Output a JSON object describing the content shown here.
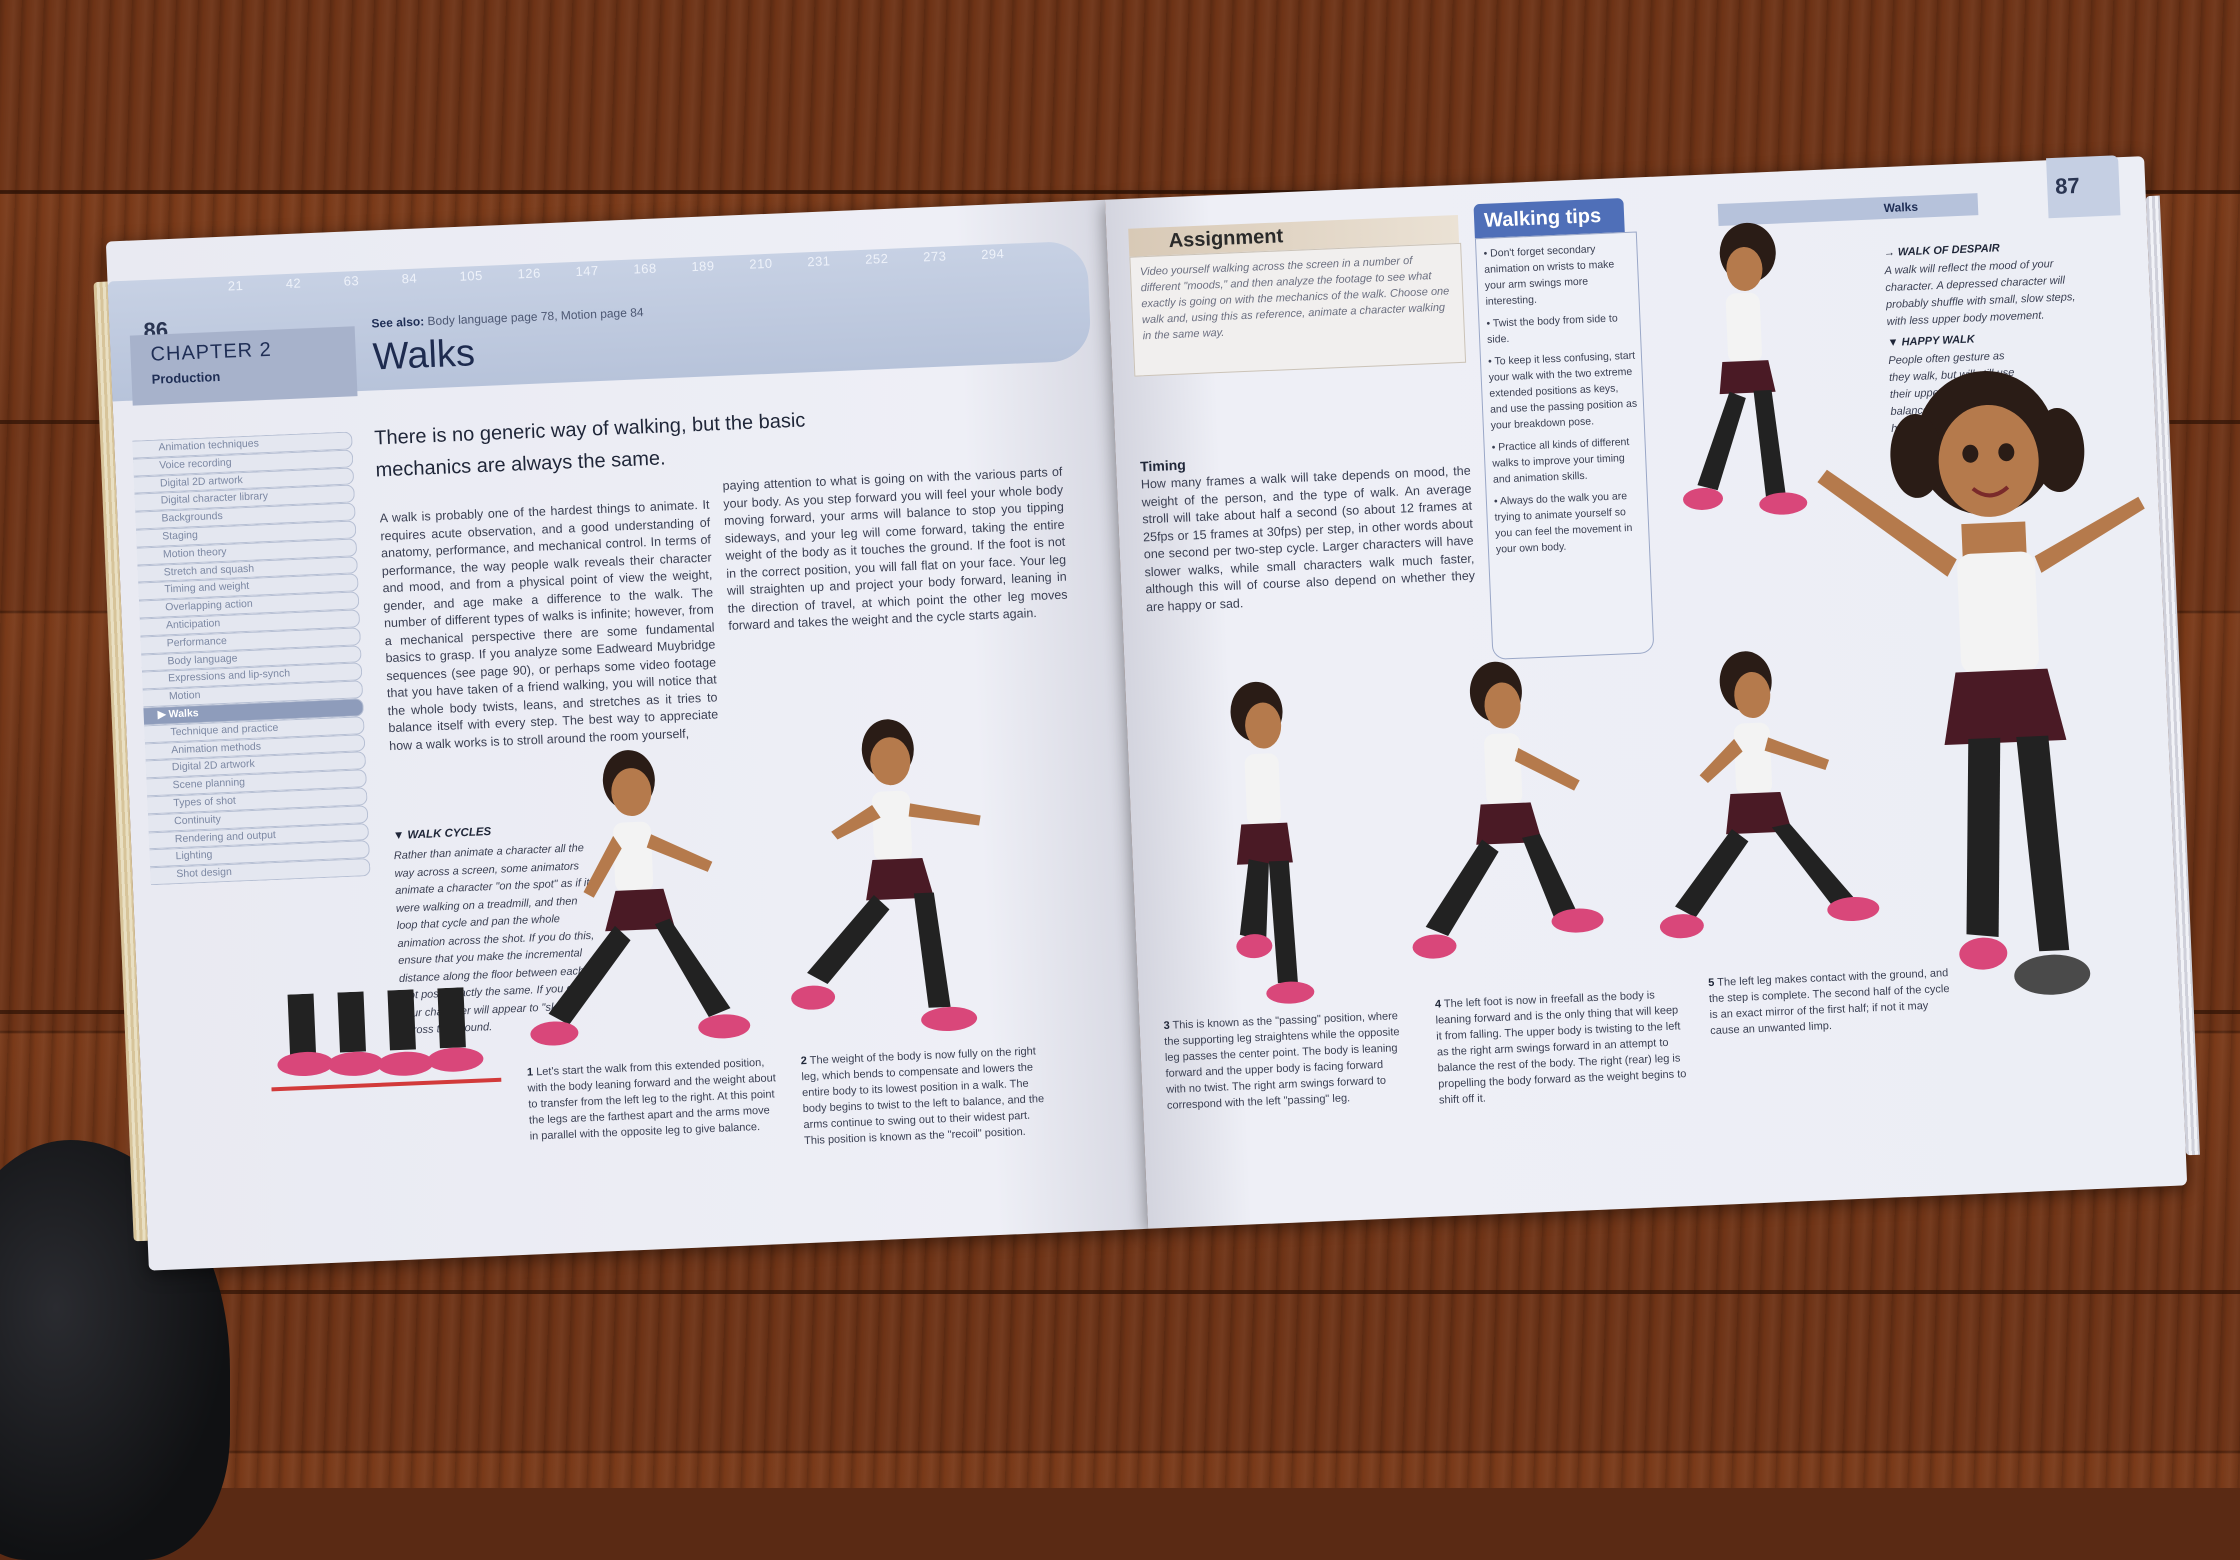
{
  "left_page": {
    "page_number": "86",
    "chapter": "CHAPTER 2",
    "chapter_sub": "Production",
    "see_also_label": "See also:",
    "see_also_text": "Body language page 78, Motion page 84",
    "title": "Walks",
    "toc": [
      "Animation techniques",
      "Voice recording",
      "Digital 2D artwork",
      "Digital character library",
      "Backgrounds",
      "Staging",
      "Motion theory",
      "Stretch and squash",
      "Timing and weight",
      "Overlapping action",
      "Anticipation",
      "Performance",
      "Body language",
      "Expressions and lip-synch",
      "Motion",
      "▶ Walks",
      "Technique and practice",
      "Animation methods",
      "Digital 2D artwork",
      "Scene planning",
      "Types of shot",
      "Continuity",
      "Rendering and output",
      "Lighting",
      "Shot design"
    ],
    "intro": "There is no generic way of walking, but the basic mechanics are always the same.",
    "body_col1": "A walk is probably one of the hardest things to animate. It requires acute observation, and a good understanding of anatomy, performance, and mechanical control. In terms of performance, the way people walk reveals their character and mood, and from a physical point of view the weight, gender, and age make a difference to the walk. The number of different types of walks is infinite; however, from a mechanical perspective there are some fundamental basics to grasp. If you analyze some Eadweard Muybridge sequences (see page 90), or perhaps some video footage that you have taken of a friend walking, you will notice that the whole body twists, leans, and stretches as it tries to balance itself with every step. The best way to appreciate how a walk works is to stroll around the room yourself,",
    "body_col2": "paying attention to what is going on with the various parts of your body. As you step forward you will feel your whole body moving forward, your arms will balance to stop you tipping sideways, and your leg will come forward, taking the entire weight of the body as it touches the ground. If the foot is not in the correct position, you will fall flat on your face. Your leg will straighten up and project your body forward, leaning in the direction of travel, at which point the other leg moves forward and takes the weight and the cycle starts again.",
    "walk_cycles_title": "▼ WALK CYCLES",
    "walk_cycles_text": "Rather than animate a character all the way across a screen, some animators animate a character \"on the spot\" as if it were walking on a treadmill, and then loop that cycle and pan the whole animation across the shot. If you do this, ensure that you make the incremental distance along the floor between each foot pose exactly the same. If you don't, your character will appear to \"skate\" across the ground.",
    "step1": "Let's start the walk from this extended position, with the body leaning forward and the weight about to transfer from the left leg to the right. At this point the legs are the farthest apart and the arms move in parallel with the opposite leg to give balance.",
    "step2": "The weight of the body is now fully on the right leg, which bends to compensate and lowers the entire body to its lowest position in a walk. The body begins to twist to the left to balance, and the arms continue to swing out to their widest part. This position is known as the \"recoil\" position."
  },
  "right_page": {
    "page_number": "87",
    "assignment_title": "Assignment",
    "assignment_text": "Video yourself walking across the screen in a number of different \"moods,\" and then analyze the footage to see what exactly is going on with the mechanics of the walk. Choose one walk and, using this as reference, animate a character walking in the same way.",
    "tips_title": "Walking tips",
    "tips": [
      "• Don't forget secondary animation on wrists to make your arm swings more interesting.",
      "• Twist the body from side to side.",
      "• To keep it less confusing, start your walk with the two extreme extended positions as keys, and use the passing position as your breakdown pose.",
      "• Practice all kinds of different walks to improve your timing and animation skills.",
      "• Always do the walk you are trying to animate yourself so you can feel the movement in your own body."
    ],
    "walks_tab": "Walks",
    "timing_title": "Timing",
    "timing_text": "How many frames a walk will take depends on mood, the weight of the person, and the type of walk. An average stroll will take about half a second (so about 12 frames at 25fps or 15 frames at 30fps) per step, in other words about one second per two-step cycle. Larger characters will have slower walks, while small characters walk much faster, although this will of course also depend on whether they are happy or sad.",
    "despair_title": "→ WALK OF DESPAIR",
    "despair_text": "A walk will reflect the mood of your character. A depressed character will probably shuffle with small, slow steps, with less upper body movement.",
    "happy_title": "▼ HAPPY WALK",
    "happy_text": "People often gesture as they walk, but will still use their upper body for balance. Happy walks have bigger, quicker strides, and probably more bounce than usual.",
    "step3": "This is known as the \"passing\" position, where the supporting leg straightens while the opposite leg passes the center point. The body is leaning forward and the upper body is facing forward with no twist. The right arm swings forward to correspond with the left \"passing\" leg.",
    "step4": "The left foot is now in freefall as the body is leaning forward and is the only thing that will keep it from falling. The upper body is twisting to the left as the right arm swings forward in an attempt to balance the rest of the body. The right (rear) leg is propelling the body forward as the weight begins to shift off it.",
    "step5": "The left leg makes contact with the ground, and the step is complete. The second half of the cycle is an exact mirror of the first half; if not it may cause an unwanted limp."
  },
  "ruler_ticks": [
    "21",
    "42",
    "63",
    "84",
    "105",
    "126",
    "147",
    "168",
    "189",
    "210",
    "231",
    "252",
    "273",
    "294"
  ],
  "colors": {
    "accent": "#4f6fb8",
    "header": "#b7c3da",
    "skin": "#b57a4c",
    "skirt": "#4a1a25",
    "shoe": "#d9477a"
  }
}
